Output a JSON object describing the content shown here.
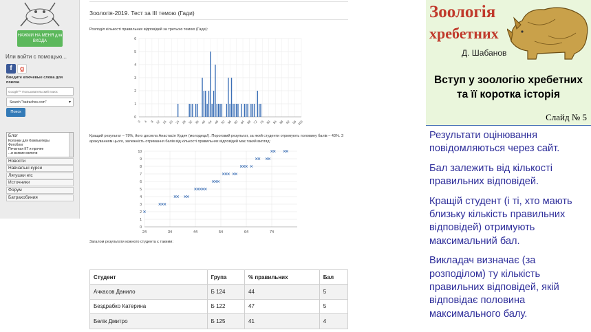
{
  "sidebar": {
    "register_label": "НАЖМИ НА МЕНЯ для ВХОДА",
    "login_with": "Или войти с помощью...",
    "social_icons": [
      "facebook-icon",
      "google-icon"
    ],
    "keywords_label": "Введите ключевые слова для поиска",
    "google_placeholder": "Google™ Пользовательский поиск",
    "site_select": "Search \"batrachos.com\"",
    "search_button": "Поиск",
    "blog_title": "Блог",
    "blog_items": [
      "Колонки для Компьютеры",
      "Фотоблог",
      "Печатная КТ и прочее",
      "...и всякие мелочи"
    ],
    "nav_items": [
      "Новости",
      "Навчальні курси",
      "Лягушки etc",
      "Источники",
      "Форум",
      "Батрахобиния"
    ]
  },
  "main": {
    "title": "Зоологія-2019. Тест за ІІІ темою (Гади)",
    "p1": "Розподіл кількості правильних відповідей за третьою темою (Гади):",
    "p2": "Кращий результат – 79%, його досягла Анастасія Худич (молодець!). Пороговий результат, за який студенти отримують половину балів – 43%. З арахуванням цього, залежність отримання балів від кількості правильних відповідей має такий вигляд:",
    "p3": "Загалом результати кожного студента є такими:",
    "table": {
      "headers": [
        "Студент",
        "Група",
        "% правильних",
        "Бал"
      ],
      "rows": [
        [
          "Ачкасов Данило",
          "Б 124",
          "44",
          "5"
        ],
        [
          "Бездрабко Катерина",
          "Б 122",
          "47",
          "5"
        ],
        [
          "Белік Дмитро",
          "Б 125",
          "41",
          "4"
        ]
      ]
    }
  },
  "chart_data": [
    {
      "type": "bar",
      "x": [
        24,
        31,
        32,
        33,
        35,
        36,
        39,
        40,
        41,
        42,
        43,
        44,
        45,
        46,
        47,
        48,
        49,
        50,
        51,
        54,
        55,
        56,
        57,
        58,
        59,
        60,
        61,
        63,
        65,
        66,
        67,
        69,
        70,
        71,
        73,
        74,
        75
      ],
      "values": [
        1,
        1,
        1,
        1,
        1,
        1,
        3,
        2,
        2,
        1,
        2,
        5,
        1,
        2,
        4,
        1,
        1,
        1,
        1,
        1,
        3,
        1,
        3,
        1,
        1,
        1,
        1,
        1,
        1,
        1,
        1,
        1,
        1,
        1,
        2,
        1,
        1
      ],
      "xticks": [
        0,
        4,
        8,
        12,
        16,
        20,
        24,
        28,
        32,
        36,
        40,
        44,
        48,
        52,
        56,
        60,
        64,
        68,
        72,
        76,
        80,
        84,
        88,
        92,
        96,
        100
      ],
      "ylim": [
        0,
        6
      ],
      "grid": true
    },
    {
      "type": "scatter",
      "x": [
        24,
        30,
        31,
        32,
        36,
        37,
        40,
        41,
        44,
        45,
        46,
        47,
        48,
        51,
        52,
        53,
        55,
        56,
        57,
        59,
        60,
        62,
        63,
        64,
        66,
        68,
        69,
        72,
        73,
        74,
        75,
        79,
        80
      ],
      "y": [
        2,
        3,
        3,
        3,
        4,
        4,
        4,
        4,
        5,
        5,
        5,
        5,
        5,
        6,
        6,
        6,
        7,
        7,
        7,
        7,
        7,
        8,
        8,
        8,
        8,
        9,
        9,
        9,
        9,
        10,
        10,
        10,
        10
      ],
      "xticks": [
        24,
        34,
        44,
        54,
        64,
        74
      ],
      "ylim": [
        0,
        10
      ],
      "grid": true
    }
  ],
  "slide": {
    "title1": "Зоологія",
    "title2": "хребетних",
    "author": "Д. Шабанов",
    "intro_line1": "Вступ у зоологію хребетних",
    "intro_line2": "та її коротка історія",
    "slide_no": "Слайд № 5",
    "paragraphs": [
      "Результати оцінювання повідомляються через сайт.",
      "Бал залежить від кількості правильних відповідей.",
      "Кращій студент (і ті, хто мають близьку кількість правильних відповідей) отримують максимальний бал.",
      "Викладач визначає (за розподілом) ту кількість правильних відповідей, якій відповідає половина максимального балу."
    ]
  },
  "colors": {
    "slide_text": "#2e2e9a",
    "slide_title": "#c0392b",
    "slide_bg": "#eaf6dc",
    "chart_bar": "#3b6fb6"
  }
}
